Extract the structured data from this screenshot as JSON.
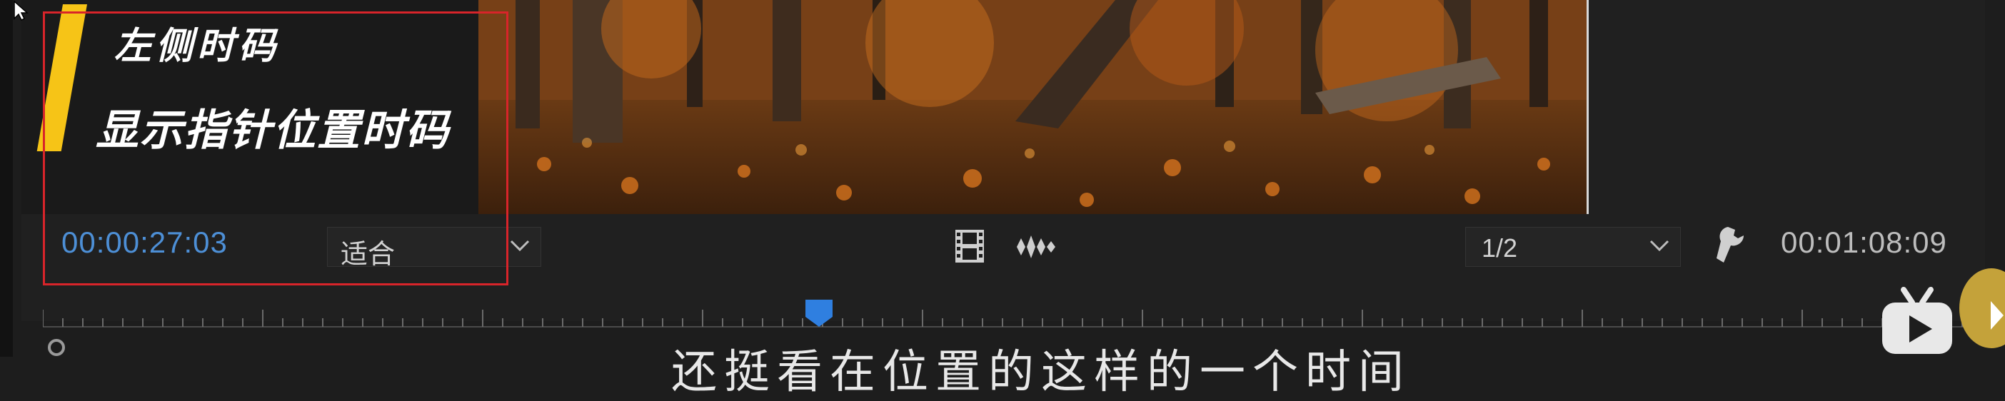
{
  "caption": {
    "line1": "左侧时码",
    "line2": "显示指针位置时码"
  },
  "controls": {
    "current_timecode": "00:00:27:03",
    "fit_dropdown": {
      "selected": "适合"
    },
    "resolution_dropdown": {
      "selected": "1/2"
    },
    "duration_timecode": "00:01:08:09"
  },
  "icons": {
    "filmstrip": "filmstrip-icon",
    "waveform": "audio-waveform-icon",
    "wrench": "wrench-icon",
    "playhead": "playhead-marker-icon",
    "logo": "tv-logo-icon"
  },
  "colors": {
    "timecode_blue": "#4d8fd6",
    "highlight_red": "#d8242a",
    "caption_yellow": "#f6c417",
    "playhead_blue": "#2f7fe0"
  },
  "subtitle": "还挺看在位置的这样的一个时间"
}
